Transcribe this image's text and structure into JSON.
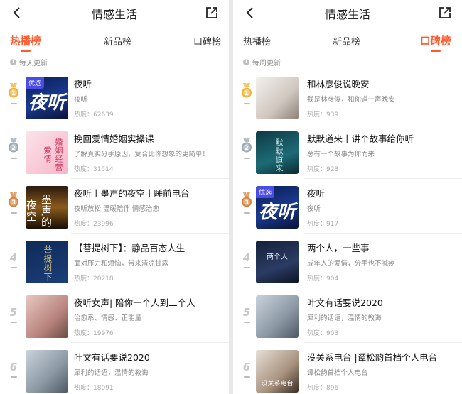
{
  "left": {
    "title": "情感生活",
    "tabs": [
      {
        "label": "热播榜",
        "active": true
      },
      {
        "label": "新品榜",
        "active": false
      },
      {
        "label": "口碑榜",
        "active": false
      }
    ],
    "note": "每天更新",
    "items": [
      {
        "rank": "1",
        "medal": "gold",
        "title": "夜听",
        "desc": "夜听",
        "heat": "热度：62639",
        "cover": {
          "tag": "优选",
          "text": "夜听"
        }
      },
      {
        "rank": "2",
        "medal": "silver",
        "title": "挽回爱情婚姻实操课",
        "desc": "了解真实分手原因，复合比你想象的更简单！",
        "heat": "热度：31514",
        "cover": {
          "text": "婚姻经营爱情"
        }
      },
      {
        "rank": "3",
        "medal": "bronze",
        "title": "夜听丨墨声的夜空丨睡前电台",
        "desc": "夜听放松 温暖陪伴 情感治愈",
        "heat": "热度：23996",
        "cover": {
          "text": "墨声的夜空"
        }
      },
      {
        "rank": "4",
        "medal": "",
        "title": "【菩提树下】：静品百态人生",
        "desc": "面对压力和烦恼，带来清凉甘露",
        "heat": "热度：20218",
        "cover": {
          "text": "菩提树下"
        }
      },
      {
        "rank": "5",
        "medal": "",
        "title": "夜听女声| 陪你一个人到二个人",
        "desc": "治愈系、情感、正能量",
        "heat": "热度：19976",
        "cover": {
          "text": ""
        }
      },
      {
        "rank": "6",
        "medal": "",
        "title": "叶文有话要说2020",
        "desc": "犀利的话语，温情的教诲",
        "heat": "热度：18091",
        "cover": {
          "text": ""
        }
      }
    ]
  },
  "right": {
    "title": "情感生活",
    "tabs": [
      {
        "label": "热播榜",
        "active": false
      },
      {
        "label": "新品榜",
        "active": false
      },
      {
        "label": "口碑榜",
        "active": true
      }
    ],
    "note": "每周更新",
    "items": [
      {
        "rank": "1",
        "medal": "gold",
        "title": "和林彦俊说晚安",
        "desc": "我是林彦俊，和你道一声晚安",
        "heat": "热度：939",
        "cover": {
          "text": ""
        }
      },
      {
        "rank": "2",
        "medal": "silver",
        "title": "默默道来丨讲个故事给你听",
        "desc": "总有一个故事为你而来",
        "heat": "热度：923",
        "cover": {
          "text": "默默道来"
        }
      },
      {
        "rank": "3",
        "medal": "bronze",
        "title": "夜听",
        "desc": "夜听",
        "heat": "热度：917",
        "cover": {
          "tag": "优选",
          "text": "夜听"
        }
      },
      {
        "rank": "4",
        "medal": "",
        "title": "两个人，一些事",
        "desc": "成年人的爱情，分手也不喊疼",
        "heat": "热度：904",
        "cover": {
          "text": "两个人"
        }
      },
      {
        "rank": "5",
        "medal": "",
        "title": "叶文有话要说2020",
        "desc": "犀利的话语，温情的教诲",
        "heat": "热度：903",
        "cover": {
          "text": ""
        }
      },
      {
        "rank": "6",
        "medal": "",
        "title": "没关系电台 |谭松韵首档个人电台",
        "desc": "谭松韵首档个人电台",
        "heat": "热度：896",
        "cover": {
          "text": "没关系电台"
        }
      }
    ]
  },
  "colors": {
    "accent": "#ff5a2d",
    "gold": "#f2b233",
    "silver": "#9aa7b4",
    "bronze": "#d7843f"
  },
  "icons": {
    "back": "chevron-left-icon",
    "share": "share-external-icon",
    "info": "info-icon"
  }
}
